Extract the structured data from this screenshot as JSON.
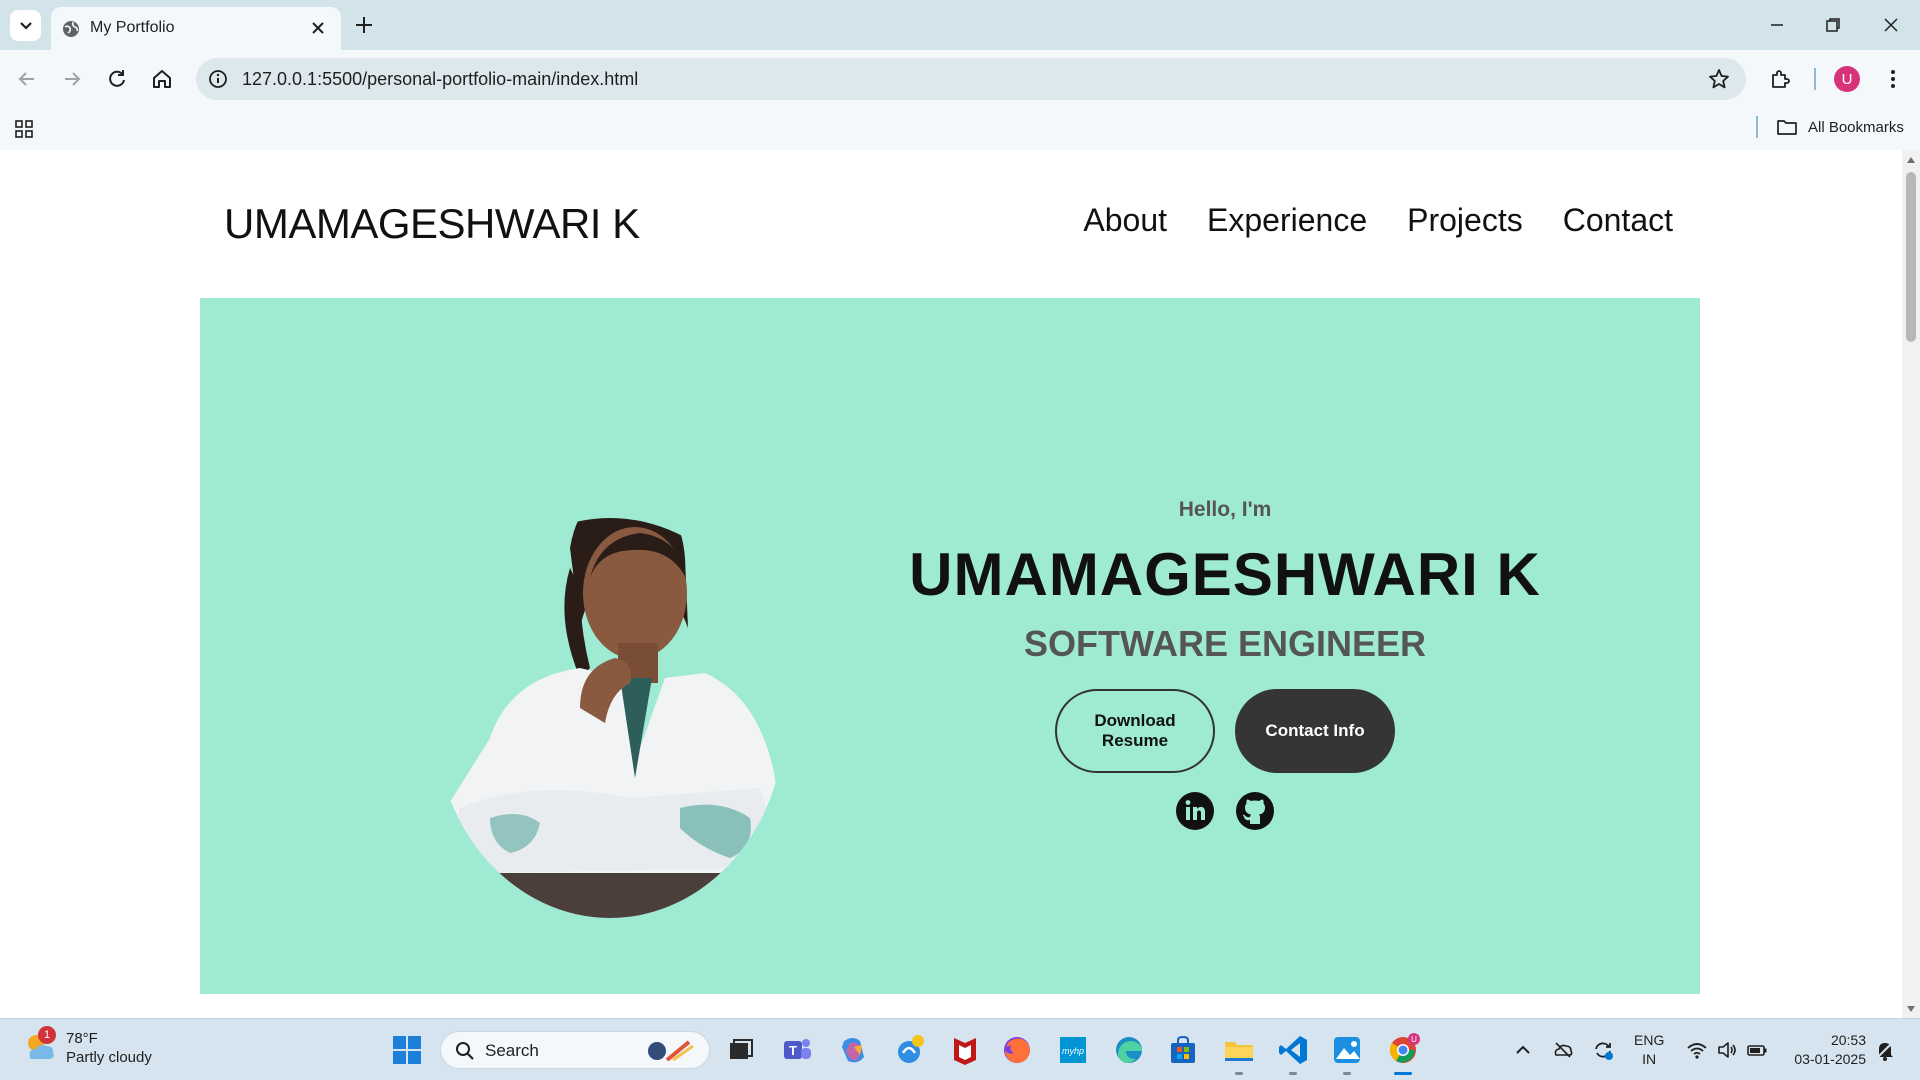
{
  "browser": {
    "tab_title": "My Portfolio",
    "url": "127.0.0.1:5500/personal-portfolio-main/index.html",
    "all_bookmarks_label": "All Bookmarks",
    "profile_initial": "U"
  },
  "site": {
    "logo": "UMAMAGESHWARI K",
    "nav": [
      "About",
      "Experience",
      "Projects",
      "Contact"
    ],
    "hero": {
      "greeting": "Hello, I'm",
      "name": "UMAMAGESHWARI K",
      "role": "SOFTWARE ENGINEER",
      "download_button": "Download Resume",
      "contact_button": "Contact Info",
      "hero_bg_color": "#9eead3"
    }
  },
  "taskbar": {
    "weather_temp": "78°F",
    "weather_desc": "Partly cloudy",
    "weather_badge": "1",
    "search_placeholder": "Search",
    "lang_line1": "ENG",
    "lang_line2": "IN",
    "time": "20:53",
    "date": "03-01-2025"
  }
}
